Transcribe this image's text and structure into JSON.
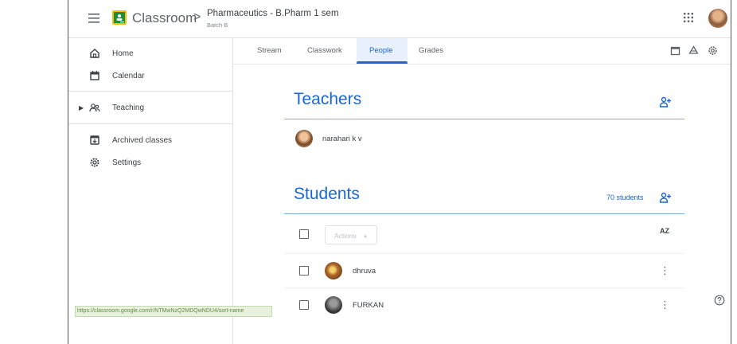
{
  "header": {
    "app_name": "Classroom",
    "separator": ">",
    "course_title": "Pharmaceutics - B.Pharm 1 sem",
    "course_section": "Batch B"
  },
  "sidebar": {
    "items": [
      {
        "label": "Home",
        "icon": "home-icon"
      },
      {
        "label": "Calendar",
        "icon": "calendar-icon"
      },
      {
        "label": "Teaching",
        "icon": "people-icon"
      },
      {
        "label": "Archived classes",
        "icon": "archive-icon"
      },
      {
        "label": "Settings",
        "icon": "gear-icon"
      }
    ]
  },
  "tabs": [
    {
      "label": "Stream",
      "active": false
    },
    {
      "label": "Classwork",
      "active": false
    },
    {
      "label": "People",
      "active": true
    },
    {
      "label": "Grades",
      "active": false
    }
  ],
  "teachers": {
    "title": "Teachers",
    "list": [
      {
        "name": "narahari k v"
      }
    ]
  },
  "students": {
    "title": "Students",
    "count_label": "70 students",
    "actions_label": "Actions",
    "sort_label": "AZ",
    "list": [
      {
        "name": "dhruva"
      },
      {
        "name": "FURKAN"
      }
    ]
  },
  "status_bar": {
    "url": "https://classroom.google.com/r/NTMwNzQ2MDQwNDU4/sort-name"
  },
  "colors": {
    "accent": "#1967d2",
    "logo_green": "#1e8e3e",
    "logo_yellow": "#fbbc04"
  }
}
